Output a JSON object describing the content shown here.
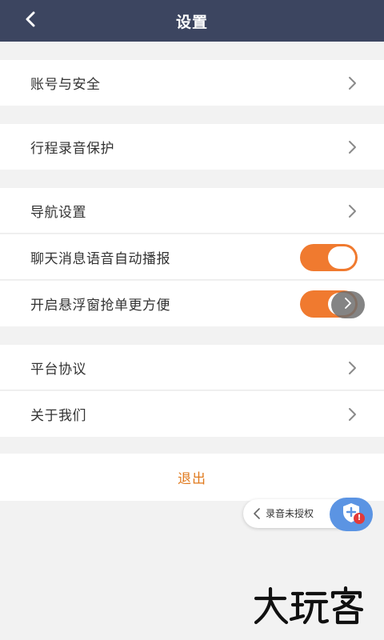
{
  "header": {
    "title": "设置",
    "back_icon": "back-arrow-icon"
  },
  "groups": [
    {
      "items": [
        {
          "label": "账号与安全",
          "control": "chevron"
        }
      ]
    },
    {
      "items": [
        {
          "label": "行程录音保护",
          "control": "chevron"
        }
      ]
    },
    {
      "items": [
        {
          "label": "导航设置",
          "control": "chevron"
        },
        {
          "label": "聊天消息语音自动播报",
          "control": "toggle",
          "on": true
        },
        {
          "label": "开启悬浮窗抢单更方便",
          "control": "toggle",
          "on": true
        }
      ]
    },
    {
      "items": [
        {
          "label": "平台协议",
          "control": "chevron"
        },
        {
          "label": "关于我们",
          "control": "chevron"
        }
      ]
    }
  ],
  "logout": {
    "label": "退出"
  },
  "floating": {
    "recording_text": "录音未授权",
    "badge": "!",
    "icon": "shield-icon"
  },
  "colors": {
    "header_bg": "#3c4560",
    "accent_orange": "#f07a2f",
    "logout_text": "#e07a1e",
    "shield_blue": "#5b94e3",
    "badge_red": "#e23a3a",
    "background": "#f2f2f2"
  }
}
